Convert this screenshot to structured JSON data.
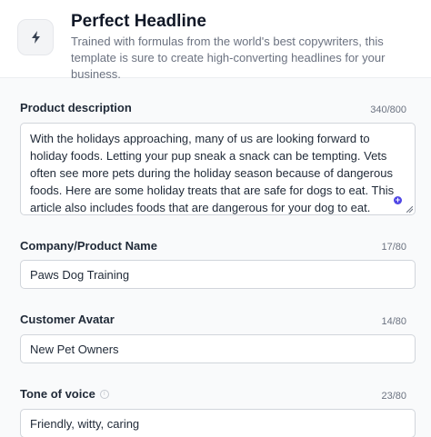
{
  "header": {
    "icon": "lightning-bolt-icon",
    "title": "Perfect Headline",
    "subtitle": "Trained with formulas from the world's best copywriters, this template is sure to create high-converting headlines for your business."
  },
  "fields": {
    "product_description": {
      "label": "Product description",
      "counter": "340/800",
      "value": "With the holidays approaching, many of us are looking forward to holiday foods. Letting your pup sneak a snack can be tempting. Vets often see more pets during the holiday season because of dangerous foods. Here are some holiday treats that are safe for dogs to eat. This article also includes foods that are dangerous for your dog to eat."
    },
    "company_name": {
      "label": "Company/Product Name",
      "counter": "17/80",
      "value": "Paws Dog Training"
    },
    "customer_avatar": {
      "label": "Customer Avatar",
      "counter": "14/80",
      "value": "New Pet Owners"
    },
    "tone_of_voice": {
      "label": "Tone of voice",
      "counter": "23/80",
      "value": "Friendly, witty, caring"
    }
  },
  "colors": {
    "accent": "#4f46e5",
    "border": "#d1d5db",
    "muted_text": "#6b7280"
  }
}
